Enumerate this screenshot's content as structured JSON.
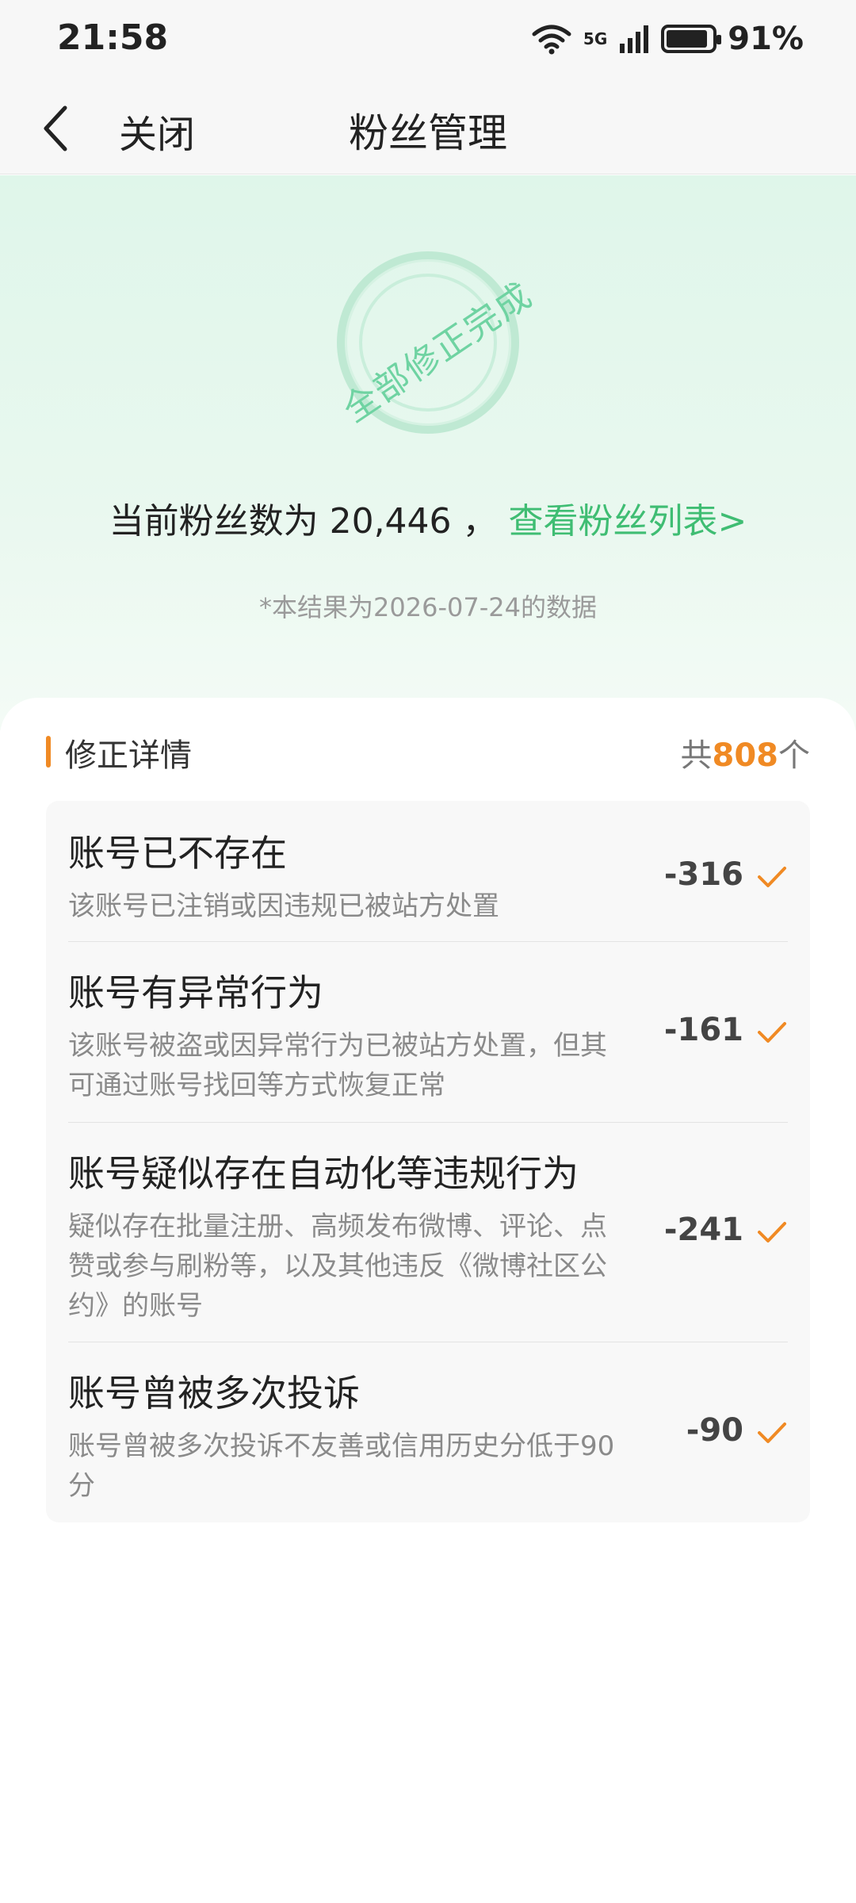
{
  "status_bar": {
    "time": "21:58",
    "network": "5G",
    "battery_percent": "91%",
    "battery_level": 0.91
  },
  "nav": {
    "close_label": "关闭",
    "title": "粉丝管理"
  },
  "hero": {
    "stamp_text": "全部修正完成",
    "fans_prefix": "当前粉丝数为 ",
    "fans_count": "20,446",
    "fans_sep": " ，",
    "fans_link": "查看粉丝列表>",
    "result_note": "*本结果为2026-07-24的数据"
  },
  "details": {
    "title": "修正详情",
    "total_prefix": "共",
    "total_count": "808",
    "total_suffix": "个",
    "items": [
      {
        "title": "账号已不存在",
        "desc": "该账号已注销或因违规已被站方处置",
        "value": "-316"
      },
      {
        "title": "账号有异常行为",
        "desc": "该账号被盗或因异常行为已被站方处置，但其可通过账号找回等方式恢复正常",
        "value": "-161"
      },
      {
        "title": "账号疑似存在自动化等违规行为",
        "desc": "疑似存在批量注册、高频发布微博、评论、点赞或参与刷粉等，以及其他违反《微博社区公约》的账号",
        "value": "-241"
      },
      {
        "title": "账号曾被多次投诉",
        "desc": "账号曾被多次投诉不友善或信用历史分低于90分",
        "value": "-90"
      }
    ]
  },
  "colors": {
    "accent_orange": "#f08a24",
    "link_green": "#3fbd73",
    "stamp_green": "#6fd3a2"
  }
}
